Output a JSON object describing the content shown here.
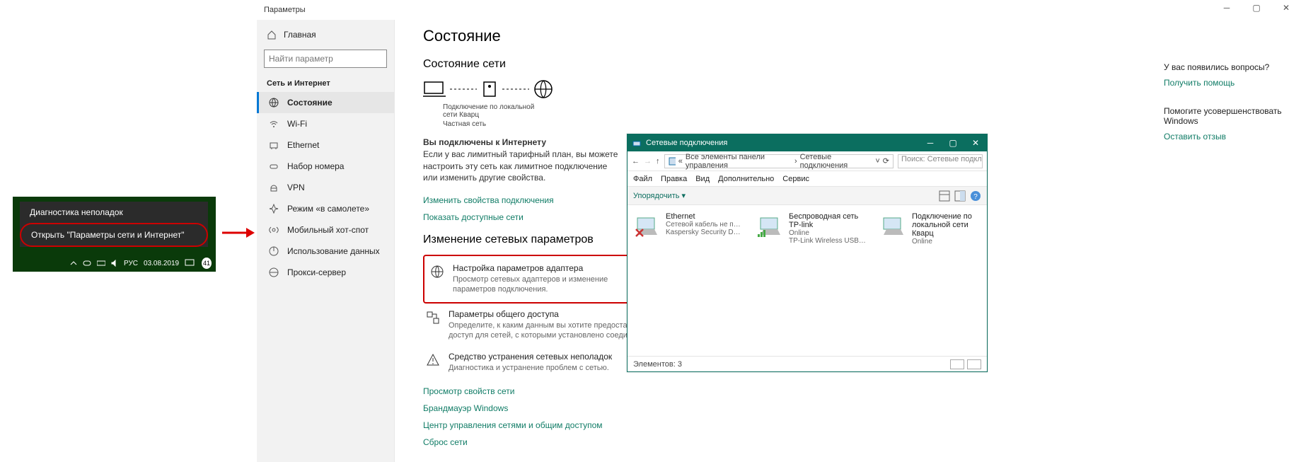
{
  "taskbar": {
    "ctx_item1": "Диагностика неполадок",
    "ctx_item2": "Открыть \"Параметры сети и Интернет\"",
    "lang": "РУС",
    "date": "03.08.2019",
    "badge": "41"
  },
  "settings": {
    "titlebar": "Параметры",
    "home": "Главная",
    "search_placeholder": "Найти параметр",
    "section": "Сеть и Интернет",
    "items": {
      "status": "Состояние",
      "wifi": "Wi-Fi",
      "ethernet": "Ethernet",
      "dialup": "Набор номера",
      "vpn": "VPN",
      "airplane": "Режим «в самолете»",
      "hotspot": "Мобильный хот-спот",
      "datausage": "Использование данных",
      "proxy": "Прокси-сервер"
    }
  },
  "main": {
    "h1": "Состояние",
    "h2": "Состояние сети",
    "conn_name": "Подключение по локальной сети Кварц",
    "conn_type": "Частная сеть",
    "connected_title": "Вы подключены к Интернету",
    "connected_desc": "Если у вас лимитный тарифный план, вы можете настроить эту сеть как лимитное подключение или изменить другие свойства.",
    "link_change": "Изменить свойства подключения",
    "link_show": "Показать доступные сети",
    "h3": "Изменение сетевых параметров",
    "adapter_title": "Настройка параметров адаптера",
    "adapter_sub": "Просмотр сетевых адаптеров и изменение параметров подключения.",
    "sharing_title": "Параметры общего доступа",
    "sharing_sub": "Определите, к каким данным вы хотите предоставить доступ для сетей, с которыми установлено соединение.",
    "troubleshoot_title": "Средство устранения сетевых неполадок",
    "troubleshoot_sub": "Диагностика и устранение проблем с сетью.",
    "link_props": "Просмотр свойств сети",
    "link_firewall": "Брандмауэр Windows",
    "link_center": "Центр управления сетями и общим доступом",
    "link_reset": "Сброс сети"
  },
  "right": {
    "q1": "У вас появились вопросы?",
    "l1": "Получить помощь",
    "q2": "Помогите усовершенствовать Windows",
    "l2": "Оставить отзыв"
  },
  "netconn": {
    "title": "Сетевые подключения",
    "bc_part1": "Все элементы панели управления",
    "bc_part2": "Сетевые подключения",
    "search_placeholder": "Поиск: Сетевые подкл...",
    "menu": {
      "file": "Файл",
      "edit": "Правка",
      "view": "Вид",
      "extra": "Дополнительно",
      "service": "Сервис"
    },
    "organize": "Упорядочить",
    "items": [
      {
        "name": "Ethernet",
        "line2": "Сетевой кабель не подкл...",
        "line3": "Kaspersky Security Data Esc...",
        "disabled": true
      },
      {
        "name": "Беспроводная сеть TP-link",
        "line2": "Online",
        "line3": "TP-Link Wireless USB Adap..."
      },
      {
        "name": "Подключение по локальной сети Кварц",
        "line2": "Online",
        "line3": ""
      }
    ],
    "status_label": "Элементов:",
    "status_count": "3"
  }
}
